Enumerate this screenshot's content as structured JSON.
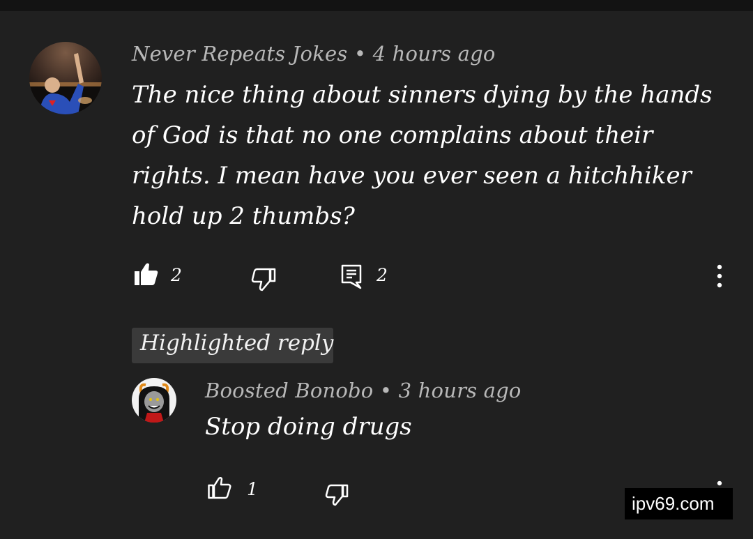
{
  "comment": {
    "author": "Never Repeats Jokes",
    "separator": "•",
    "time": "4 hours ago",
    "text": "The nice thing about sinners dying by the hands of God is that no one complains about their rights. I mean have you ever seen a hitchhiker hold up 2 thumbs?",
    "likes": "2",
    "replies": "2",
    "icons": {
      "like": "thumbs-up-filled-icon",
      "dislike": "thumbs-down-icon",
      "reply": "comment-icon",
      "more": "more-vertical-icon"
    }
  },
  "highlight_label": "Highlighted reply",
  "reply": {
    "author": "Boosted Bonobo",
    "separator": "•",
    "time": "3 hours ago",
    "text": "Stop doing drugs",
    "likes": "1",
    "icons": {
      "like": "thumbs-up-outline-icon",
      "dislike": "thumbs-down-icon",
      "more": "more-vertical-icon"
    }
  },
  "watermark": "ipv69.com",
  "colors": {
    "background": "#202020",
    "meta_text": "#b8b8b8",
    "chip": "#3a3a3a"
  }
}
